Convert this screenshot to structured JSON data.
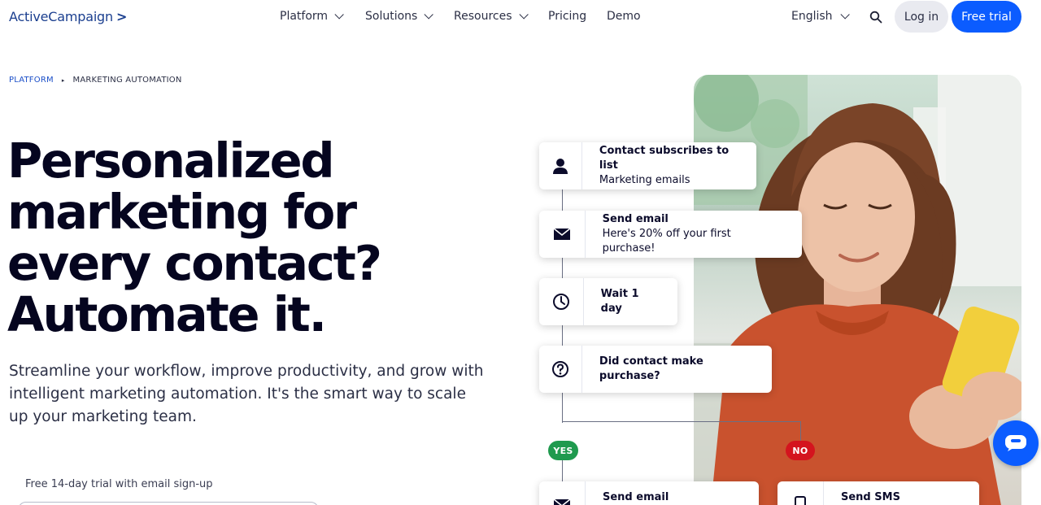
{
  "header": {
    "logo": "ActiveCampaign",
    "logo_chevron": ">",
    "nav": [
      {
        "label": "Platform",
        "has_dropdown": true
      },
      {
        "label": "Solutions",
        "has_dropdown": true
      },
      {
        "label": "Resources",
        "has_dropdown": true
      },
      {
        "label": "Pricing",
        "has_dropdown": false
      },
      {
        "label": "Demo",
        "has_dropdown": false
      }
    ],
    "language": "English",
    "search_icon": "search-icon",
    "login_label": "Log in",
    "trial_label": "Free trial"
  },
  "breadcrumb": {
    "items": [
      "PLATFORM",
      "MARKETING AUTOMATION"
    ],
    "separator": "▸"
  },
  "hero": {
    "title": "Personalized marketing for every contact? Automate it.",
    "subtitle": "Streamline your workflow, improve productivity, and grow with intelligent marketing automation. It's the smart way to scale up your marketing team.",
    "trial_note": "Free 14-day trial with email sign-up"
  },
  "workflow": {
    "cards": [
      {
        "icon": "person-icon",
        "title": "Contact subscribes to list",
        "subtitle": "Marketing emails"
      },
      {
        "icon": "envelope-icon",
        "title": "Send email",
        "subtitle": "Here's 20% off your first purchase!"
      },
      {
        "icon": "clock-icon",
        "title": "Wait 1 day",
        "subtitle": ""
      },
      {
        "icon": "question-icon",
        "title": "Did contact make purchase?",
        "subtitle": ""
      },
      {
        "icon": "envelope-icon",
        "title": "Send email",
        "subtitle": ""
      },
      {
        "icon": "phone-icon",
        "title": "Send SMS",
        "subtitle": ""
      }
    ],
    "yes_label": "YES",
    "no_label": "NO"
  },
  "colors": {
    "brand_blue": "#0b5cff",
    "yes_green": "#1f9a4e",
    "no_red": "#d4141e",
    "sweater": "#c9522e",
    "phone_yellow": "#f2cf3c"
  },
  "chat_widget_icon": "chat-bubble-icon"
}
